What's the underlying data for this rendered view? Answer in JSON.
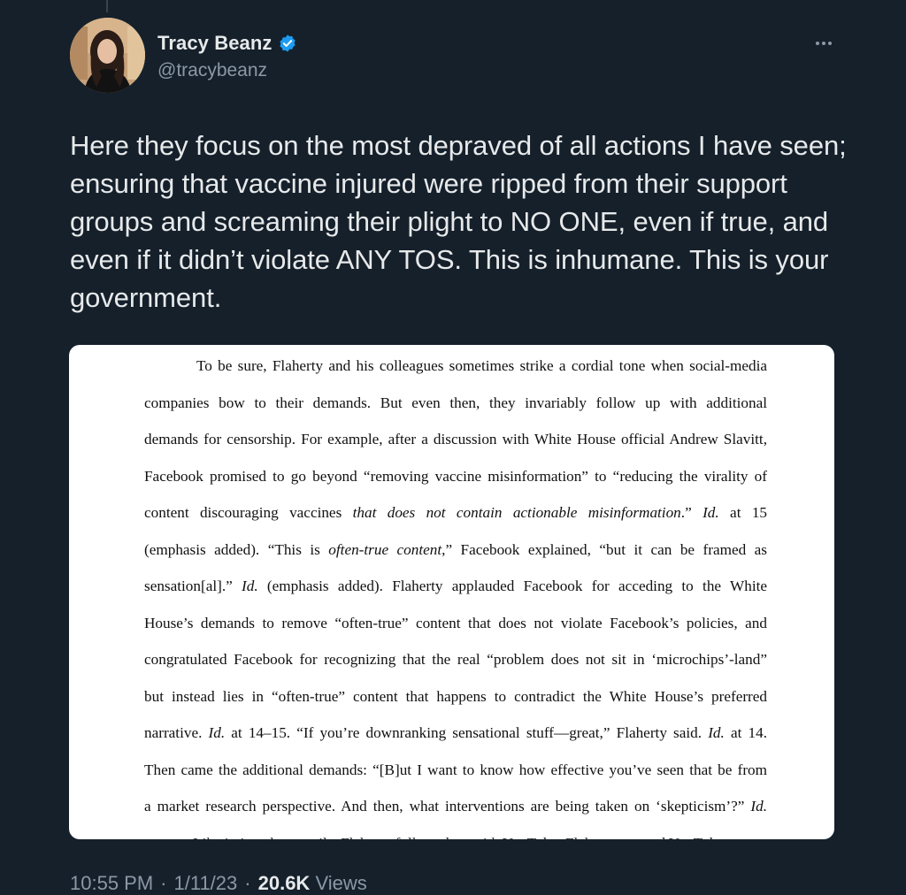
{
  "author": {
    "display_name": "Tracy Beanz",
    "handle": "@tracybeanz",
    "verified": true
  },
  "icons": {
    "verified": "verified-badge-icon",
    "more": "more-options-icon",
    "avatar": "profile-photo"
  },
  "colors": {
    "background": "#15202b",
    "text": "#e7e9ea",
    "secondary_text": "#8b98a5",
    "verified_blue": "#1d9bf0"
  },
  "tweet": {
    "text": "Here they focus on the most depraved of all actions I have seen; ensuring that vaccine injured were ripped from their support groups and screaming their plight to NO ONE, even if true, and even if it didn’t violate ANY TOS. This is inhumane. This is your government.",
    "time": "10:55 PM",
    "date": "1/11/23",
    "views_count": "20.6K",
    "views_label": "Views"
  },
  "document": {
    "lines": [
      "To be sure, Flaherty and his colleagues sometimes strike a cordial tone when social-media",
      "companies bow to their demands. But even then, they invariably follow up with additional",
      "demands for censorship. For example, after a discussion with White House official Andrew Slavitt,",
      "Facebook promised to go beyond “removing vaccine misinformation” to “reducing the virality of",
      "content discouraging vaccines <i>that does not contain actionable misinformation</i>.” <i>Id.</i> at 15",
      "(emphasis added). “This is <i>often-true content</i>,” Facebook explained, “but it can be framed as",
      "sensation[al].” <i>Id.</i> (emphasis added). Flaherty applauded Facebook for acceding to the White",
      "House’s demands to remove “often-true” content that does not violate Facebook’s policies, and",
      "congratulated Facebook for recognizing that the real “problem does not sit in ‘microchips’-land”",
      "but instead lies in “often-true” content that happens to contradict the White House’s preferred",
      "narrative. <i>Id.</i> at 14–15. “If you’re downranking sensational stuff—great,” Flaherty said. <i>Id.</i> at 14.",
      "Then came the additional demands: “[B]ut I want to know how effective you’ve seen that be from",
      "a market research perspective. And then, what interventions are being taken on ‘skepticism’?” <i>Id.</i>",
      "Like in its other emails, Flaherty followed up with YouTube. Flaherty pressed YouTube"
    ]
  }
}
